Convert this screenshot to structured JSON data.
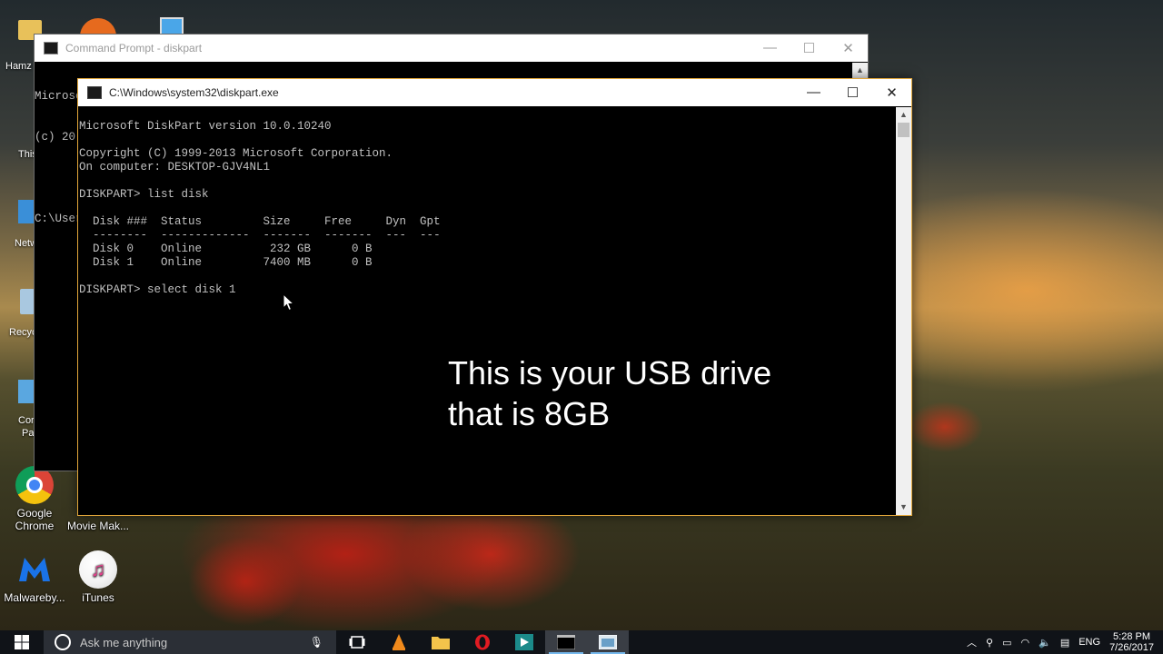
{
  "desktop": {
    "icons": [
      {
        "label": "Google Chrome",
        "line1": "Google",
        "line2": "Chrome"
      },
      {
        "label": "Movie Mak..."
      },
      {
        "label": "Malwareby..."
      },
      {
        "label": "iTunes"
      }
    ],
    "edge_labels": {
      "hamz": "Hamz",
      "this": "This",
      "netw": "Netw",
      "recyc": "Recyc",
      "cor": "Cor",
      "pa": "Pa"
    }
  },
  "bg_window": {
    "title": "Command Prompt - diskpart",
    "lines": [
      "Microsoft Windows [Version 10.0.10240]",
      "(c) 20",
      "",
      "C:\\User"
    ]
  },
  "fg_window": {
    "title": "C:\\Windows\\system32\\diskpart.exe",
    "lines": [
      "Microsoft DiskPart version 10.0.10240",
      "",
      "Copyright (C) 1999-2013 Microsoft Corporation.",
      "On computer: DESKTOP-GJV4NL1",
      "",
      "DISKPART> list disk",
      "",
      "  Disk ###  Status         Size     Free     Dyn  Gpt",
      "  --------  -------------  -------  -------  ---  ---",
      "  Disk 0    Online          232 GB      0 B",
      "  Disk 1    Online         7400 MB      0 B",
      "",
      "DISKPART> select disk 1"
    ]
  },
  "overlay": {
    "line1": "This is your USB drive",
    "line2": "that is 8GB"
  },
  "taskbar": {
    "search_placeholder": "Ask me anything",
    "language": "ENG",
    "time": "5:28 PM",
    "date": "7/26/2017"
  }
}
